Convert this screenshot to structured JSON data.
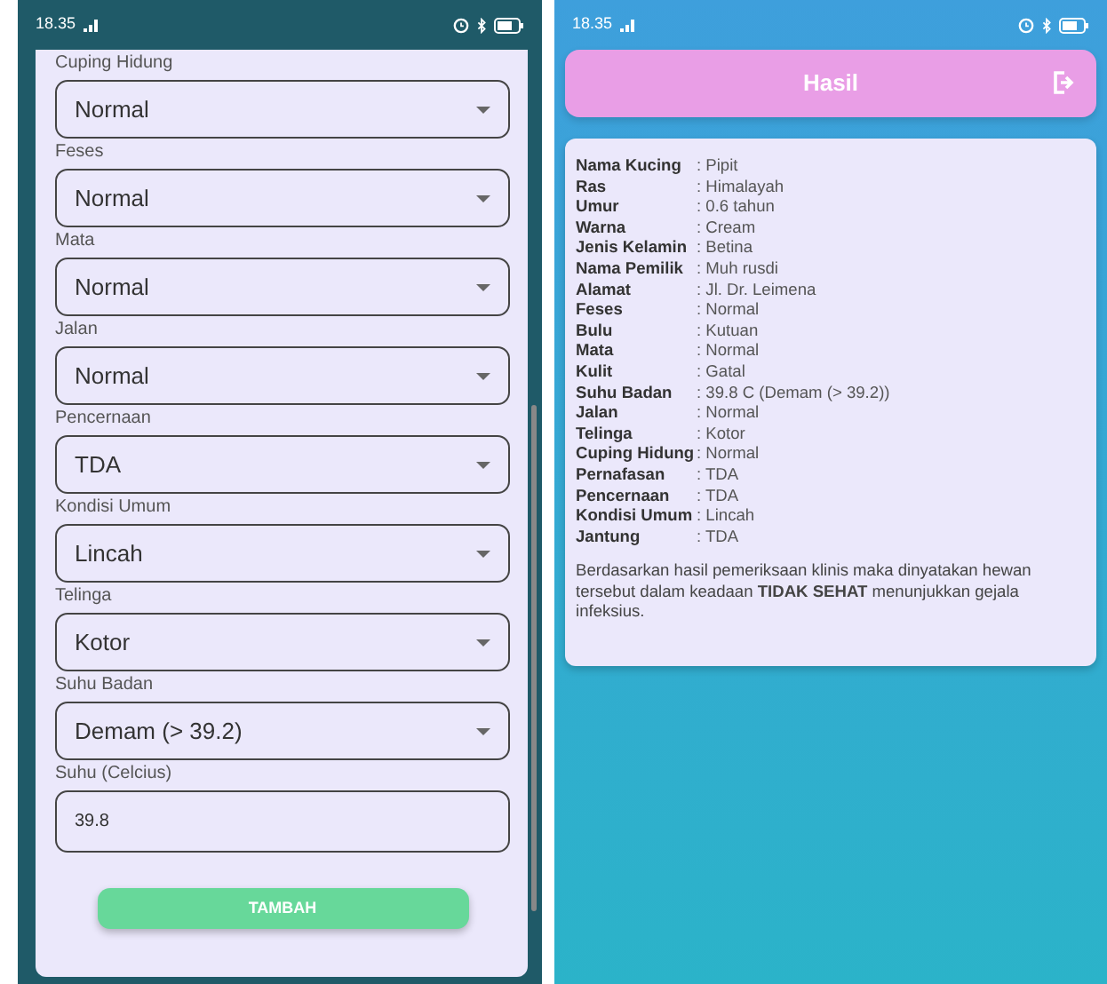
{
  "form_screen": {
    "status_bar": {
      "time": "18.35"
    },
    "fields": [
      {
        "label": "Cuping Hidung",
        "kind": "select",
        "value": "Normal"
      },
      {
        "label": "Feses",
        "kind": "select",
        "value": "Normal"
      },
      {
        "label": "Mata",
        "kind": "select",
        "value": "Normal"
      },
      {
        "label": "Jalan",
        "kind": "select",
        "value": "Normal"
      },
      {
        "label": "Pencernaan",
        "kind": "select",
        "value": "TDA"
      },
      {
        "label": "Kondisi Umum",
        "kind": "select",
        "value": "Lincah"
      },
      {
        "label": "Telinga",
        "kind": "select",
        "value": "Kotor"
      },
      {
        "label": "Suhu Badan",
        "kind": "select",
        "value": "Demam (> 39.2)"
      },
      {
        "label": "Suhu (Celcius)",
        "kind": "input",
        "value": "39.8"
      }
    ],
    "submit_button": "TAMBAH"
  },
  "result_screen": {
    "status_bar": {
      "time": "18.35"
    },
    "header": {
      "title": "Hasil"
    },
    "details": [
      {
        "label": "Nama Kucing",
        "value": ": Pipit"
      },
      {
        "label": "Ras",
        "value": ": Himalayah"
      },
      {
        "label": "Umur",
        "value": ": 0.6 tahun"
      },
      {
        "label": "Warna",
        "value": ": Cream"
      },
      {
        "label": "Jenis Kelamin",
        "value": ": Betina"
      },
      {
        "label": "Nama Pemilik",
        "value": ": Muh rusdi"
      },
      {
        "label": "Alamat",
        "value": ": Jl. Dr. Leimena"
      },
      {
        "label": "Feses",
        "value": ": Normal"
      },
      {
        "label": "Bulu",
        "value": ": Kutuan"
      },
      {
        "label": "Mata",
        "value": ": Normal"
      },
      {
        "label": "Kulit",
        "value": ": Gatal"
      },
      {
        "label": "Suhu Badan",
        "value": ": 39.8 C (Demam (> 39.2))"
      },
      {
        "label": "Jalan",
        "value": ": Normal"
      },
      {
        "label": "Telinga",
        "value": ": Kotor"
      },
      {
        "label": "Cuping Hidung",
        "value": ": Normal"
      },
      {
        "label": "Pernafasan",
        "value": ": TDA"
      },
      {
        "label": "Pencernaan",
        "value": ": TDA"
      },
      {
        "label": "Kondisi Umum",
        "value": ": Lincah"
      },
      {
        "label": "Jantung",
        "value": ": TDA"
      }
    ],
    "conclusion": "Berdasarkan hasil pemeriksaan klinis maka dinyatakan hewan tersebut dalam keadaan **TIDAK SEHAT**  menunjukkan gejala infeksius."
  }
}
